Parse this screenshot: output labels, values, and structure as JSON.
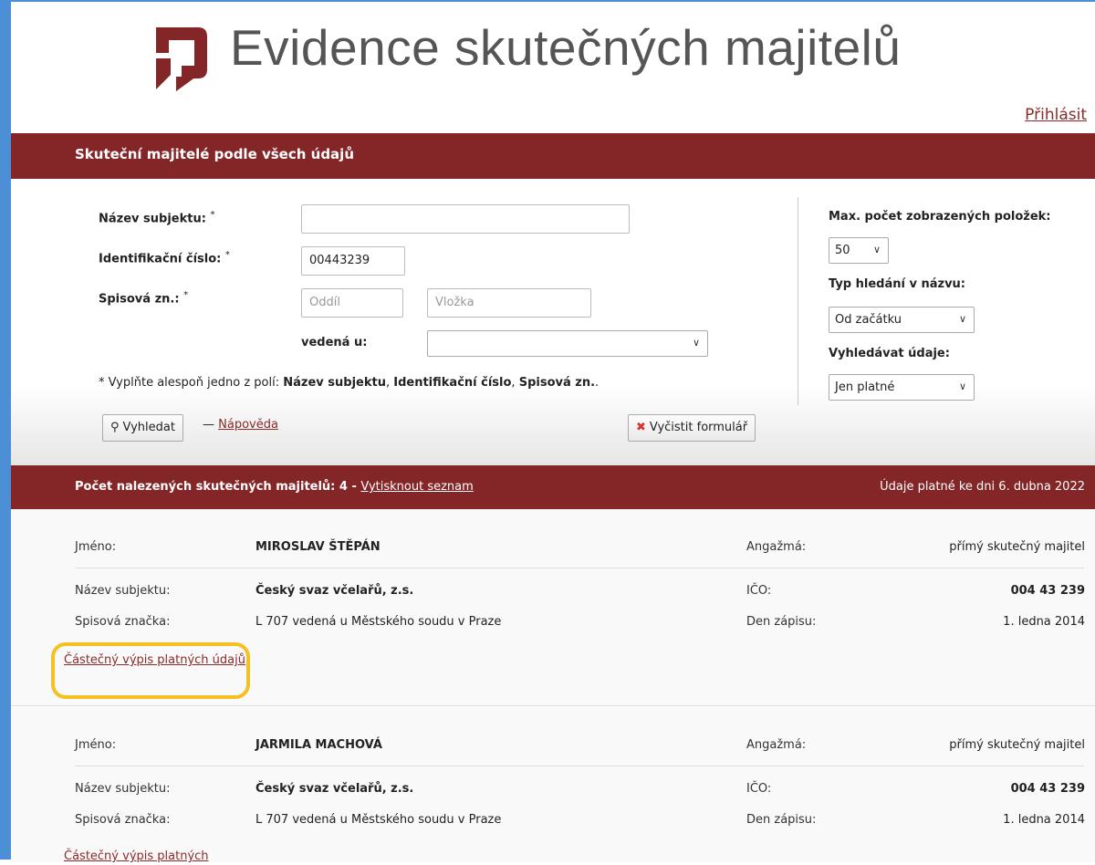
{
  "header": {
    "title": "Evidence skutečných majitelů",
    "login": "Přihlásit",
    "logo_color": "#842628"
  },
  "search": {
    "section_title": "Skuteční majitelé podle všech údajů",
    "fields": {
      "name_label": "Název subjektu:",
      "name_value": "",
      "id_label": "Identifikační číslo:",
      "id_value": "00443239",
      "file_label": "Spisová zn.:",
      "section_placeholder": "Oddíl",
      "insert_placeholder": "Vložka",
      "court_label": "vedená u:",
      "court_value": "",
      "required_mark": "*"
    },
    "hint": {
      "prefix": "* Vyplňte alespoň jedno z polí:",
      "f1": "Název subjektu",
      "sep1": ",",
      "f2": "Identifikační číslo",
      "sep2": ",",
      "f3": "Spisová zn.",
      "end": "."
    },
    "options": {
      "max_label": "Max. počet zobrazených položek:",
      "max_value": "50",
      "type_label": "Typ hledání v názvu:",
      "type_value": "Od začátku",
      "data_label": "Vyhledávat údaje:",
      "data_value": "Jen platné"
    },
    "buttons": {
      "search": "Vyhledat",
      "dash": "—",
      "help": "Nápověda",
      "clear": "Vyčistit formulář"
    }
  },
  "results": {
    "count_text": "Počet nalezených skutečných majitelů: 4 -",
    "print_link": "Vytisknout seznam",
    "valid_text": "Údaje platné ke dni 6. dubna 2022",
    "labels": {
      "name": "Jméno:",
      "role": "Angažmá:",
      "subject": "Název subjektu:",
      "ico": "IČO:",
      "file": "Spisová značka:",
      "reg_date": "Den zápisu:"
    },
    "records": [
      {
        "name": "MIROSLAV ŠTĚPÁN",
        "role": "přímý skutečný majitel",
        "subject": "Český svaz včelařů, z.s.",
        "ico": "004 43 239",
        "file": "L 707 vedená u Městského soudu v Praze",
        "reg_date": "1. ledna 2014",
        "extract_link": "Částečný výpis platných údajů"
      },
      {
        "name": "JARMILA MACHOVÁ",
        "role": "přímý skutečný majitel",
        "subject": "Český svaz včelařů, z.s.",
        "ico": "004 43 239",
        "file": "L 707 vedená u Městského soudu v Praze",
        "reg_date": "1. ledna 2014",
        "extract_link": "Částečný výpis platných"
      }
    ]
  }
}
